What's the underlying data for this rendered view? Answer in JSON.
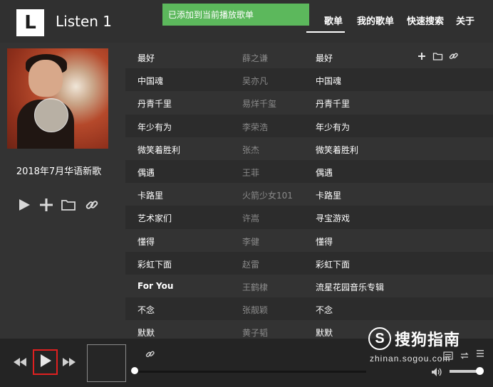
{
  "app": {
    "logo_letter": "L",
    "title": "Listen 1"
  },
  "toast": {
    "message": "已添加到当前播放歌单"
  },
  "nav": {
    "items": [
      {
        "label": "歌单"
      },
      {
        "label": "我的歌单"
      },
      {
        "label": "快速搜索"
      },
      {
        "label": "关于"
      }
    ]
  },
  "sidebar": {
    "album_title": "2018年7月华语新歌",
    "actions": [
      {
        "icon": "play-icon"
      },
      {
        "icon": "plus-icon"
      },
      {
        "icon": "folder-icon"
      },
      {
        "icon": "link-icon"
      }
    ]
  },
  "tracks": [
    {
      "title": "最好",
      "artist": "薛之谦",
      "album": "最好"
    },
    {
      "title": "中国魂",
      "artist": "吴亦凡",
      "album": "中国魂"
    },
    {
      "title": "丹青千里",
      "artist": "易烊千玺",
      "album": "丹青千里"
    },
    {
      "title": "年少有为",
      "artist": "李荣浩",
      "album": "年少有为"
    },
    {
      "title": "微笑着胜利",
      "artist": "张杰",
      "album": "微笑着胜利"
    },
    {
      "title": "偶遇",
      "artist": "王菲",
      "album": "偶遇"
    },
    {
      "title": "卡路里",
      "artist": "火箭少女101",
      "album": "卡路里"
    },
    {
      "title": "艺术家们",
      "artist": "许嵩",
      "album": "寻宝游戏"
    },
    {
      "title": "懂得",
      "artist": "李健",
      "album": "懂得"
    },
    {
      "title": "彩虹下面",
      "artist": "赵雷",
      "album": "彩虹下面"
    },
    {
      "title": "For You",
      "artist": "王鹤棣",
      "album": "流星花园音乐专辑"
    },
    {
      "title": "不念",
      "artist": "张靓颖",
      "album": "不念"
    },
    {
      "title": "默默",
      "artist": "黄子韬",
      "album": "默默"
    }
  ],
  "track_row_actions": [
    {
      "icon": "plus-icon"
    },
    {
      "icon": "folder-icon"
    },
    {
      "icon": "link-icon"
    }
  ],
  "player": {
    "controls": [
      {
        "icon": "previous-icon"
      },
      {
        "icon": "play-icon"
      },
      {
        "icon": "next-icon"
      }
    ],
    "progress": 0,
    "volume": 0.85
  },
  "watermark": {
    "logo_letter": "S",
    "brand": "搜狗指南",
    "url": "zhinan.sogou.com"
  },
  "colors": {
    "toast_bg": "#5cb85c",
    "highlight_border": "#e02020",
    "background": "#333333"
  }
}
